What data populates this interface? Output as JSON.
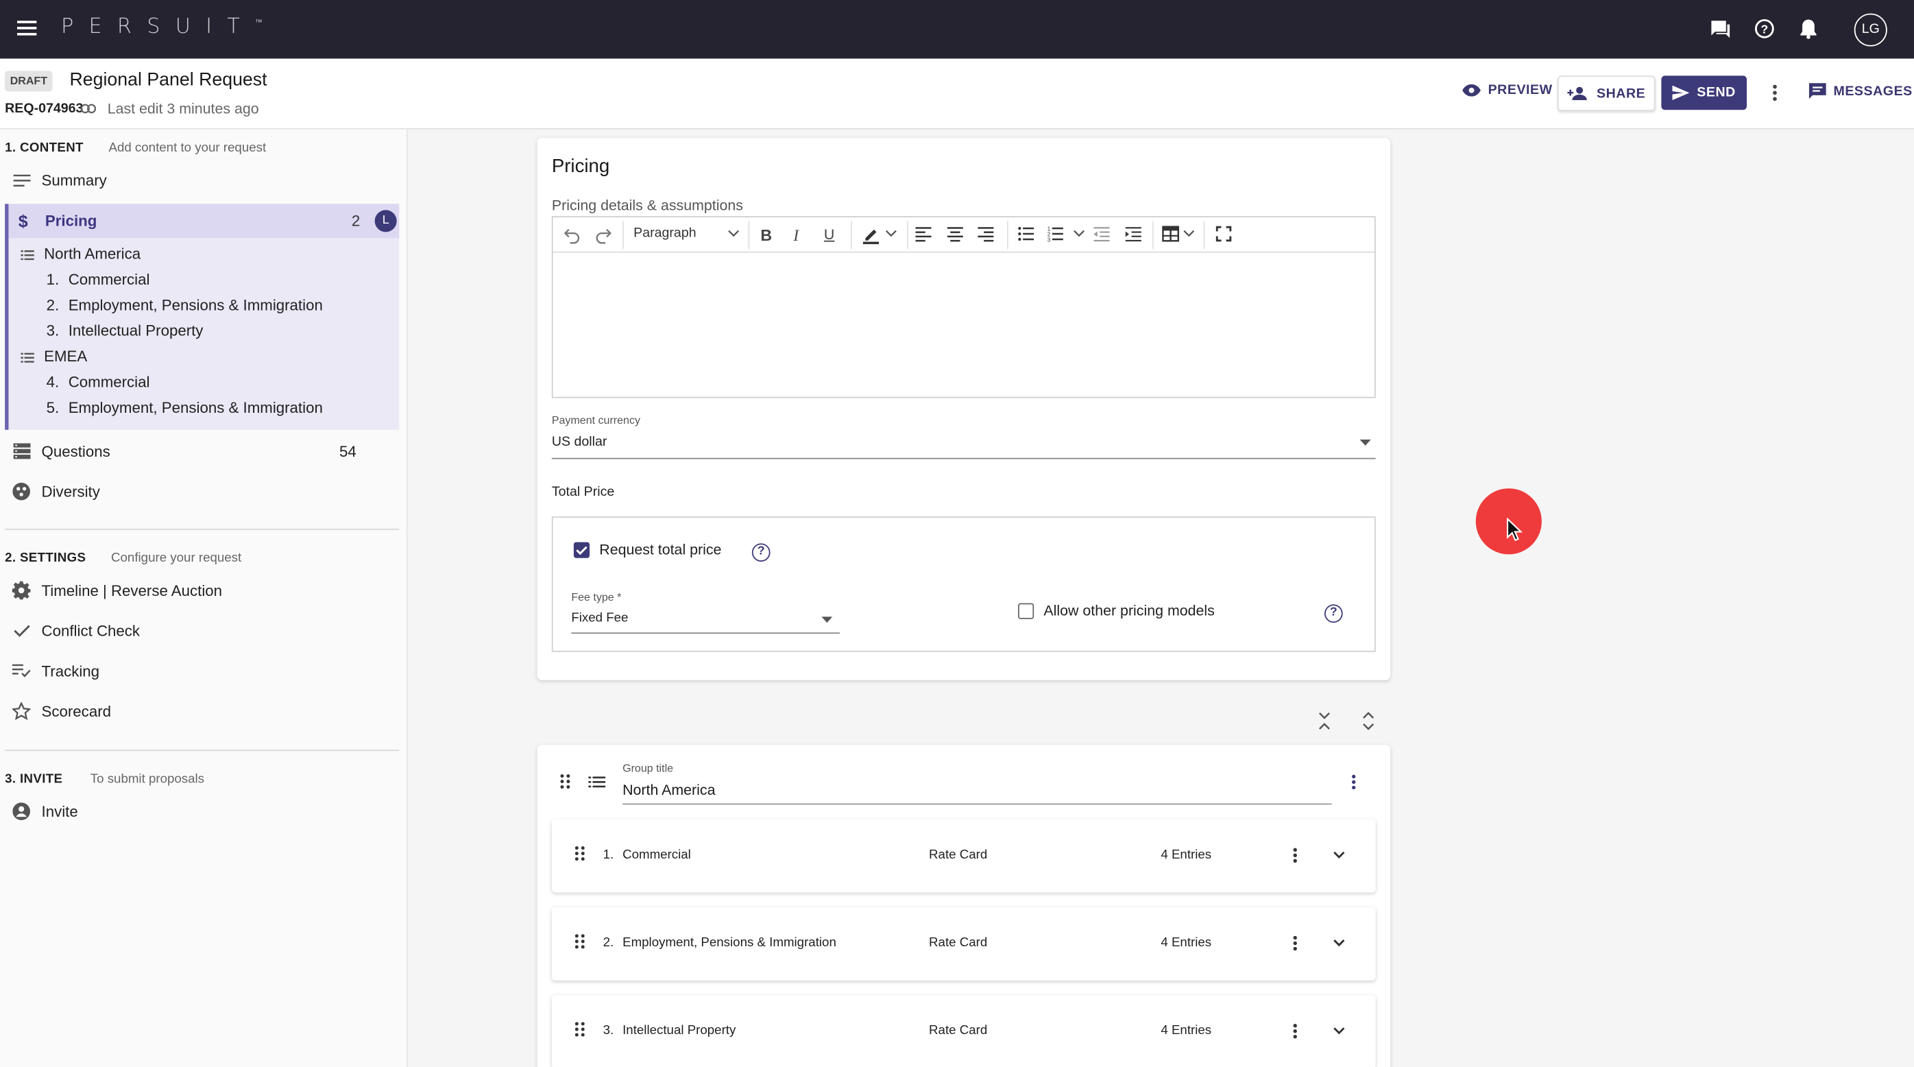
{
  "topbar": {
    "logo": "PERSUIT",
    "logo_tm": "™",
    "avatar": "LG"
  },
  "header": {
    "status": "DRAFT",
    "title": "Regional Panel Request",
    "request_id": "REQ-074963",
    "last_edit": "Last edit 3 minutes ago",
    "preview": "PREVIEW",
    "share": "SHARE",
    "send": "SEND",
    "messages": "MESSAGES"
  },
  "sidebar": {
    "content": {
      "header": "1. CONTENT",
      "sub": "Add content to your request",
      "summary": "Summary",
      "pricing": {
        "label": "Pricing",
        "count": "2",
        "avatar": "L"
      },
      "tree": [
        {
          "type": "group",
          "label": "North America"
        },
        {
          "type": "item",
          "num": "1.",
          "label": "Commercial"
        },
        {
          "type": "item",
          "num": "2.",
          "label": "Employment, Pensions & Immigration"
        },
        {
          "type": "item",
          "num": "3.",
          "label": "Intellectual Property"
        },
        {
          "type": "group",
          "label": "EMEA"
        },
        {
          "type": "item",
          "num": "4.",
          "label": "Commercial"
        },
        {
          "type": "item",
          "num": "5.",
          "label": "Employment, Pensions & Immigration"
        }
      ],
      "questions": {
        "label": "Questions",
        "count": "54"
      },
      "diversity": "Diversity"
    },
    "settings": {
      "header": "2. SETTINGS",
      "sub": "Configure your request",
      "items": [
        "Timeline | Reverse Auction",
        "Conflict Check",
        "Tracking",
        "Scorecard"
      ]
    },
    "invite": {
      "header": "3. INVITE",
      "sub": "To submit proposals",
      "item": "Invite"
    }
  },
  "pricing_card": {
    "title": "Pricing",
    "details_label": "Pricing details & assumptions",
    "paragraph_style": "Paragraph",
    "currency_label": "Payment currency",
    "currency_value": "US dollar",
    "total_price_label": "Total Price",
    "request_total_price": "Request total price",
    "request_total_checked": true,
    "fee_type_label": "Fee type *",
    "fee_type_value": "Fixed Fee",
    "allow_other": "Allow other pricing models",
    "allow_other_checked": false
  },
  "group": {
    "title_label": "Group title",
    "title_value": "North America",
    "rows": [
      {
        "num": "1.",
        "name": "Commercial",
        "type": "Rate Card",
        "entries": "4 Entries"
      },
      {
        "num": "2.",
        "name": "Employment, Pensions & Immigration",
        "type": "Rate Card",
        "entries": "4 Entries"
      },
      {
        "num": "3.",
        "name": "Intellectual Property",
        "type": "Rate Card",
        "entries": "4 Entries"
      }
    ]
  },
  "colors": {
    "topbar": "#25232f",
    "accent": "#3d3a7a",
    "pricing_highlight": "#dcd8f2",
    "cursor_marker": "#ef3b3b"
  }
}
